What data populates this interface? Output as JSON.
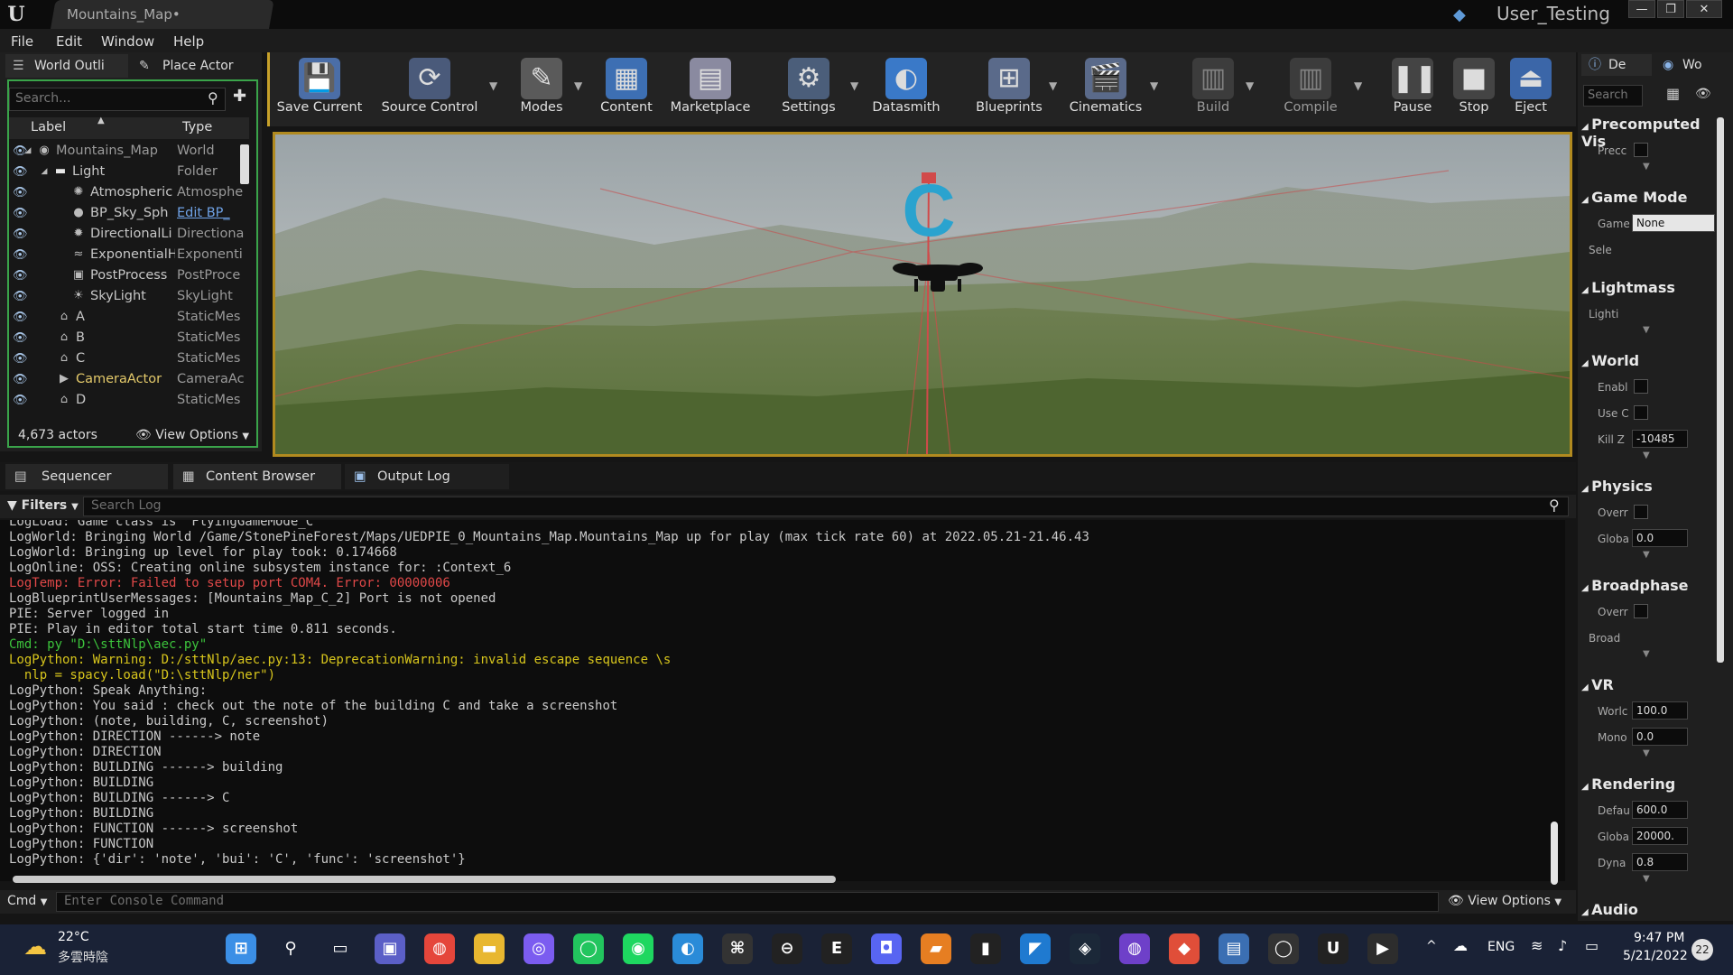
{
  "window": {
    "tab_title": "Mountains_Map•",
    "project": "User_Testing",
    "min": "—",
    "max": "❐",
    "close": "✕"
  },
  "menu": [
    "File",
    "Edit",
    "Window",
    "Help"
  ],
  "left_tabs": {
    "world_outliner": "World Outli",
    "place_actor": "Place Actor"
  },
  "outliner": {
    "search_placeholder": "Search...",
    "col_label": "Label",
    "col_type": "Type",
    "rows": [
      {
        "label": "Mountains_Map",
        "type": "World",
        "icon": "world-icon"
      },
      {
        "label": "Light",
        "type": "Folder",
        "icon": "folder-icon"
      },
      {
        "label": "Atmospheric",
        "type": "Atmosphe",
        "icon": "atmosphere-icon"
      },
      {
        "label": "BP_Sky_Sph",
        "type": "Edit BP_",
        "icon": "sphere-icon"
      },
      {
        "label": "DirectionalLi",
        "type": "Directiona",
        "icon": "sun-icon"
      },
      {
        "label": "ExponentialH",
        "type": "Exponenti",
        "icon": "fog-icon"
      },
      {
        "label": "PostProcess",
        "type": "PostProce",
        "icon": "postprocess-icon"
      },
      {
        "label": "SkyLight",
        "type": "SkyLight",
        "icon": "skylight-icon"
      },
      {
        "label": "A",
        "type": "StaticMes",
        "icon": "static-mesh-icon"
      },
      {
        "label": "B",
        "type": "StaticMes",
        "icon": "static-mesh-icon"
      },
      {
        "label": "C",
        "type": "StaticMes",
        "icon": "static-mesh-icon"
      },
      {
        "label": "CameraActor",
        "type": "CameraAc",
        "icon": "camera-icon"
      },
      {
        "label": "D",
        "type": "StaticMes",
        "icon": "static-mesh-icon"
      }
    ],
    "actor_count": "4,673 actors",
    "view_options": "View Options"
  },
  "toolbar": [
    {
      "label": "Save Current",
      "icon": "save-icon"
    },
    {
      "label": "Source Control",
      "icon": "source-control-icon"
    },
    {
      "label": "Modes",
      "icon": "modes-icon"
    },
    {
      "label": "Content",
      "icon": "content-icon"
    },
    {
      "label": "Marketplace",
      "icon": "marketplace-icon"
    },
    {
      "label": "Settings",
      "icon": "settings-icon"
    },
    {
      "label": "Datasmith",
      "icon": "datasmith-icon"
    },
    {
      "label": "Blueprints",
      "icon": "blueprints-icon"
    },
    {
      "label": "Cinematics",
      "icon": "cinematics-icon"
    },
    {
      "label": "Build",
      "icon": "build-icon"
    },
    {
      "label": "Compile",
      "icon": "compile-icon"
    },
    {
      "label": "Pause",
      "icon": "pause-icon"
    },
    {
      "label": "Stop",
      "icon": "stop-icon"
    },
    {
      "label": "Eject",
      "icon": "eject-icon"
    }
  ],
  "viewport": {
    "marker_letter": "C"
  },
  "right_panel": {
    "tabs": [
      "De",
      "Wo"
    ],
    "search_placeholder": "Search",
    "sections": [
      {
        "title": "Precomputed Vis",
        "items": [
          {
            "label": "Precc",
            "kind": "check"
          }
        ]
      },
      {
        "title": "Game Mode",
        "items": [
          {
            "label": "Game",
            "kind": "dropdown",
            "value": "None"
          },
          {
            "label": "Sele",
            "kind": "text"
          }
        ]
      },
      {
        "title": "Lightmass",
        "items": [
          {
            "label": "Lighti",
            "kind": "text"
          }
        ]
      },
      {
        "title": "World",
        "items": [
          {
            "label": "Enabl",
            "kind": "check"
          },
          {
            "label": "Use C",
            "kind": "check"
          },
          {
            "label": "Kill Z",
            "kind": "field",
            "value": "-10485"
          }
        ]
      },
      {
        "title": "Physics",
        "items": [
          {
            "label": "Overr",
            "kind": "check"
          },
          {
            "label": "Globa",
            "kind": "field",
            "value": "0.0"
          }
        ]
      },
      {
        "title": "Broadphase",
        "items": [
          {
            "label": "Overr",
            "kind": "check"
          },
          {
            "label": "Broad",
            "kind": "text"
          }
        ]
      },
      {
        "title": "VR",
        "items": [
          {
            "label": "Worlc",
            "kind": "field",
            "value": "100.0"
          },
          {
            "label": "Mono",
            "kind": "field",
            "value": "0.0"
          }
        ]
      },
      {
        "title": "Rendering",
        "items": [
          {
            "label": "Defau",
            "kind": "field",
            "value": "600.0"
          },
          {
            "label": "Globa",
            "kind": "field",
            "value": "20000."
          },
          {
            "label": "Dyna",
            "kind": "field",
            "value": "0.8"
          }
        ]
      },
      {
        "title": "Audio",
        "items": []
      }
    ]
  },
  "bottom_tabs": [
    "Sequencer",
    "Content Browser",
    "Output Log"
  ],
  "log": {
    "filters": "Filters",
    "search_placeholder": "Search Log",
    "lines": [
      {
        "text": "LogLoad: Game class is 'FlyingGameMode_C'",
        "kind": "normal"
      },
      {
        "text": "LogWorld: Bringing World /Game/StonePineForest/Maps/UEDPIE_0_Mountains_Map.Mountains_Map up for play (max tick rate 60) at 2022.05.21-21.46.43",
        "kind": "normal"
      },
      {
        "text": "LogWorld: Bringing up level for play took: 0.174668",
        "kind": "normal"
      },
      {
        "text": "LogOnline: OSS: Creating online subsystem instance for: :Context_6",
        "kind": "normal"
      },
      {
        "text": "LogTemp: Error: Failed to setup port COM4. Error: 00000006",
        "kind": "err"
      },
      {
        "text": "LogBlueprintUserMessages: [Mountains_Map_C_2] Port is not opened",
        "kind": "normal"
      },
      {
        "text": "PIE: Server logged in",
        "kind": "normal"
      },
      {
        "text": "PIE: Play in editor total start time 0.811 seconds.",
        "kind": "normal"
      },
      {
        "text": "Cmd: py \"D:\\sttNlp\\aec.py\"",
        "kind": "cmd"
      },
      {
        "text": "LogPython: Warning: D:/sttNlp/aec.py:13: DeprecationWarning: invalid escape sequence \\s",
        "kind": "warn"
      },
      {
        "text": "  nlp = spacy.load(\"D:\\sttNlp/ner\")",
        "kind": "warn"
      },
      {
        "text": "LogPython: Speak Anything:",
        "kind": "normal"
      },
      {
        "text": "LogPython: You said : check out the note of the building C and take a screenshot",
        "kind": "normal"
      },
      {
        "text": "LogPython: (note, building, C, screenshot)",
        "kind": "normal"
      },
      {
        "text": "LogPython: DIRECTION ------> note",
        "kind": "normal"
      },
      {
        "text": "LogPython: DIRECTION",
        "kind": "normal"
      },
      {
        "text": "LogPython: BUILDING ------> building",
        "kind": "normal"
      },
      {
        "text": "LogPython: BUILDING",
        "kind": "normal"
      },
      {
        "text": "LogPython: BUILDING ------> C",
        "kind": "normal"
      },
      {
        "text": "LogPython: BUILDING",
        "kind": "normal"
      },
      {
        "text": "LogPython: FUNCTION ------> screenshot",
        "kind": "normal"
      },
      {
        "text": "LogPython: FUNCTION",
        "kind": "normal"
      },
      {
        "text": "LogPython: {'dir': 'note', 'bui': 'C', 'func': 'screenshot'}",
        "kind": "normal"
      }
    ],
    "cmd_label": "Cmd",
    "cmd_placeholder": "Enter Console Command",
    "view_options": "View Options"
  },
  "taskbar": {
    "weather_temp": "22°C",
    "weather_desc": "多雲時陰",
    "apps": [
      "windows-start-icon",
      "search-icon",
      "task-view-icon",
      "teams-icon",
      "chrome-icon",
      "file-explorer-icon",
      "messenger-icon",
      "line-icon",
      "spotify-icon",
      "edge-icon",
      "app-icon",
      "obs-icon",
      "epic-games-icon",
      "discord-icon",
      "sublime-icon",
      "terminal-icon",
      "vscode-icon",
      "steam-icon",
      "github-icon",
      "git-icon",
      "notepad-icon",
      "vr-icon",
      "unreal-icon",
      "powershell-icon"
    ],
    "lang": "ENG",
    "time": "9:47 PM",
    "date": "5/21/2022",
    "notif_count": "22"
  },
  "colors": {
    "accent_green": "#3aa44a",
    "viewport_border": "#b18a1f",
    "error": "#e04848",
    "warning": "#d7c51c",
    "command": "#3cc33c"
  }
}
